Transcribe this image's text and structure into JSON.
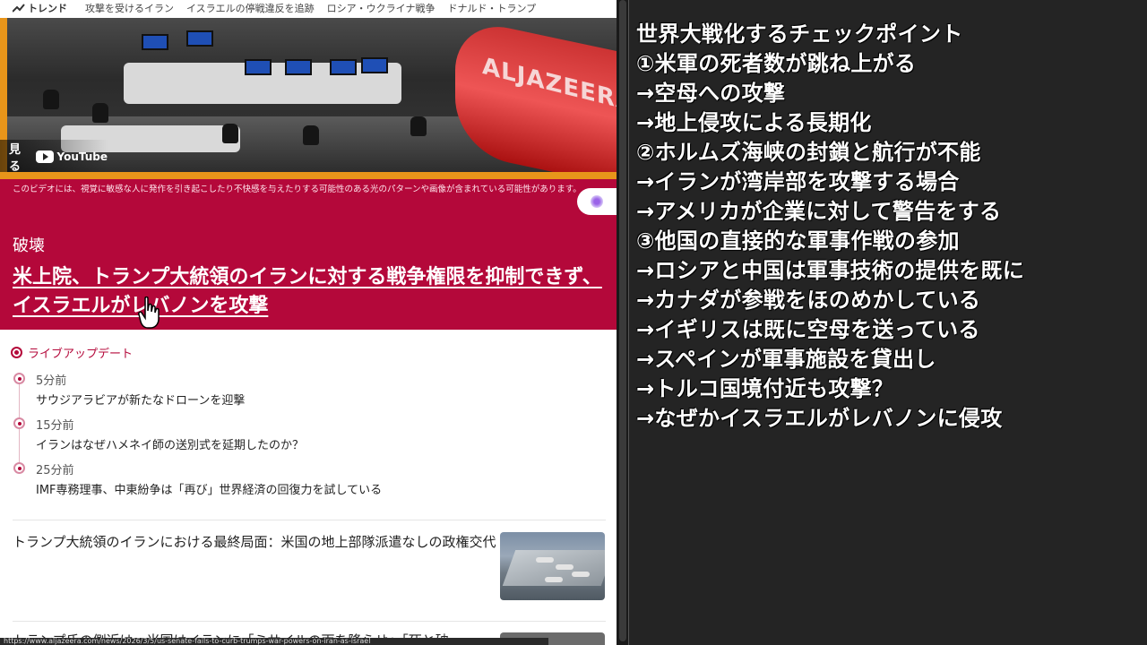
{
  "trend_bar": {
    "label": "トレンド",
    "items": [
      "攻撃を受けるイラン",
      "イスラエルの停戦違反を追跡",
      "ロシア・ウクライナ戦争",
      "ドナルド・トランプ"
    ]
  },
  "video": {
    "watch_label": "見る",
    "youtube_label": "YouTube",
    "wall_text": "ALJAZEERA"
  },
  "breaking": {
    "warning": "このビデオには、視覚に敏感な人に発作を引き起こしたり不快感を与えたりする可能性のある光のパターンや画像が含まれている可能性があります。",
    "label": "破壊",
    "headline": "米上院、トランプ大統領のイランに対する戦争権限を抑制できず、イスラエルがレバノンを攻撃"
  },
  "live": {
    "header": "ライブアップデート",
    "updates": [
      {
        "time": "5分前",
        "text": "サウジアラビアが新たなドローンを迎撃"
      },
      {
        "time": "15分前",
        "text": "イランはなぜハメネイ師の送別式を延期したのか？"
      },
      {
        "time": "25分前",
        "text": "IMF専務理事、中東紛争は「再び」世界経済の回復力を試している"
      }
    ]
  },
  "articles": [
    {
      "title": "トランプ大統領のイランにおける最終局面：米国の地上部隊派遣なしの政権交代"
    },
    {
      "title": "トランプ氏の側近は、米国はイランに「ミサイルの雨を降らせ」「死と破"
    }
  ],
  "status_url": "https://www.aljazeera.com/news/2026/3/5/us-senate-fails-to-curb-trumps-war-powers-on-iran-as-israel",
  "notes": {
    "lines": [
      "世界大戦化するチェックポイント",
      "①米軍の死者数が跳ね上がる",
      "→空母への攻撃",
      "→地上侵攻による長期化",
      "②ホルムズ海峡の封鎖と航行が不能",
      "→イランが湾岸部を攻撃する場合",
      "→アメリカが企業に対して警告をする",
      "③他国の直接的な軍事作戦の参加",
      "→ロシアと中国は軍事技術の提供を既に",
      "→カナダが参戦をほのめかしている",
      "→イギリスは既に空母を送っている",
      "→スペインが軍事施設を貸出し",
      "→トルコ国境付近も攻撃？",
      "→なぜかイスラエルがレバノンに侵攻"
    ]
  },
  "colors": {
    "breaking_red": "#b4083a",
    "accent_orange": "#e8951a",
    "panel_dark": "#242424"
  }
}
